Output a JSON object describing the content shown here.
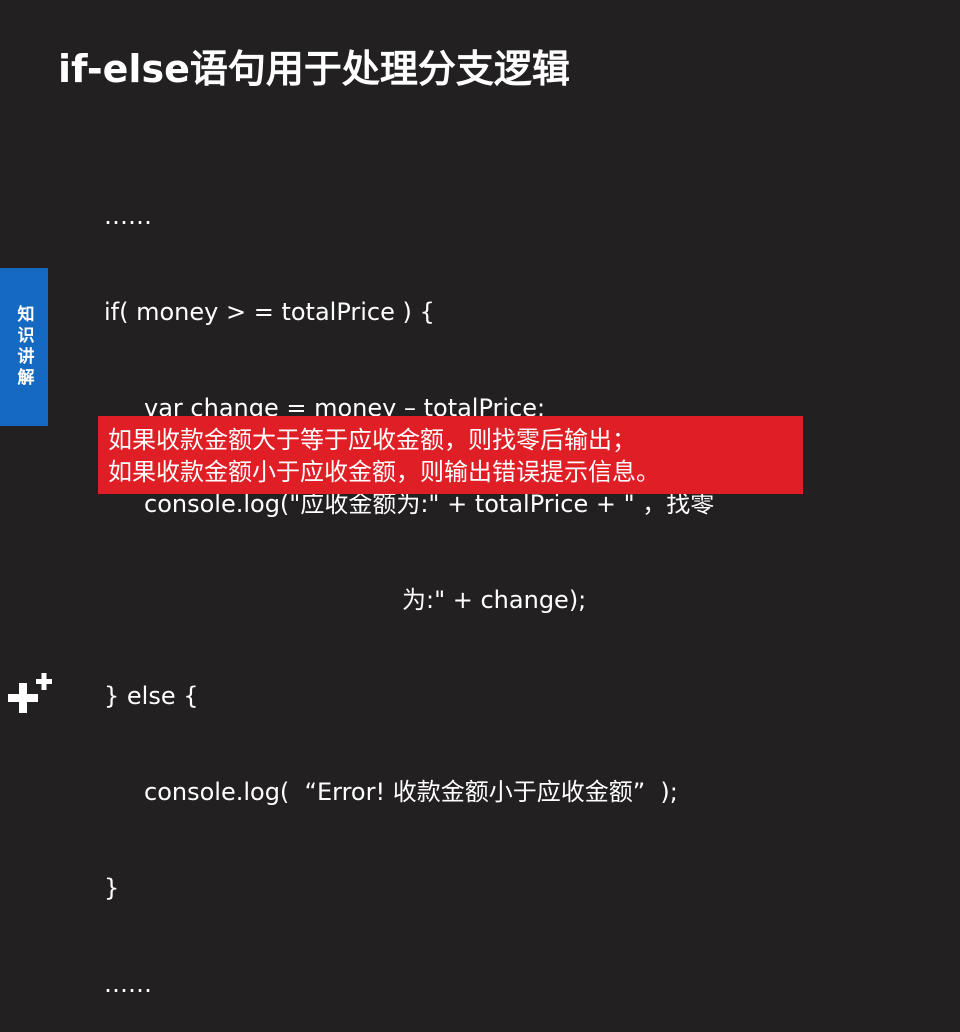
{
  "slide": {
    "title": "if-else语句用于处理分支逻辑",
    "side_tab": "知识讲解"
  },
  "code": {
    "lines": [
      "……",
      "if( money > = totalPrice ) {",
      "var change = money – totalPrice;",
      "console.log(\"应收金额为:\" + totalPrice + \" ，找零",
      "为:\" + change);",
      "} else {",
      "console.log(  “Error! 收款金额小于应收金额”  );",
      "}",
      "……"
    ]
  },
  "note": {
    "line1": "如果收款金额大于等于应收金额，则找零后输出；",
    "line2": "如果收款金额小于应收金额，则输出错误提示信息。"
  },
  "colors": {
    "background": "#222021",
    "side_tab": "#1669c0",
    "note_box": "#e01e26",
    "text": "#ffffff"
  }
}
